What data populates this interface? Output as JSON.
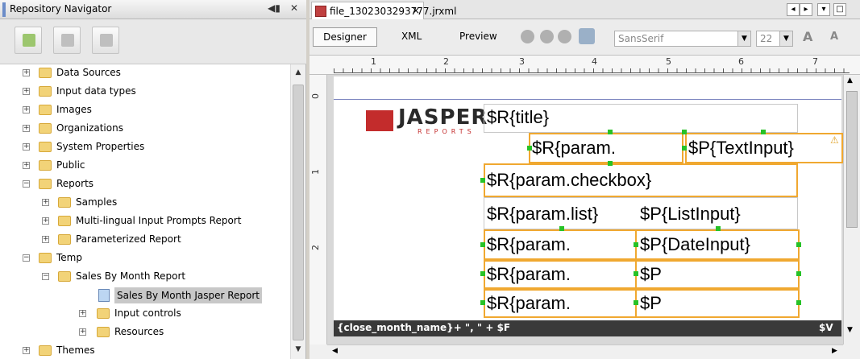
{
  "navigator": {
    "title": "Repository Navigator",
    "controls": "◀▮ ✕",
    "tree": [
      {
        "label": "Data Sources",
        "level": 1,
        "type": "folder"
      },
      {
        "label": "Input data types",
        "level": 1,
        "type": "folder"
      },
      {
        "label": "Images",
        "level": 1,
        "type": "folder"
      },
      {
        "label": "Organizations",
        "level": 1,
        "type": "folder"
      },
      {
        "label": "System Properties",
        "level": 1,
        "type": "folder"
      },
      {
        "label": "Public",
        "level": 1,
        "type": "folder"
      },
      {
        "label": "Reports",
        "level": 1,
        "type": "folder"
      },
      {
        "label": "Samples",
        "level": 2,
        "type": "folder"
      },
      {
        "label": "Multi-lingual Input Prompts Report",
        "level": 2,
        "type": "report"
      },
      {
        "label": "Parameterized Report",
        "level": 2,
        "type": "report"
      },
      {
        "label": "Temp",
        "level": 1,
        "type": "folder"
      },
      {
        "label": "Sales By Month Report",
        "level": 2,
        "type": "report"
      },
      {
        "label": "Sales By Month Jasper Report",
        "level": 3,
        "type": "jrxml"
      },
      {
        "label": "Input controls",
        "level": 3,
        "type": "folder"
      },
      {
        "label": "Resources",
        "level": 3,
        "type": "folder"
      },
      {
        "label": "Themes",
        "level": 1,
        "type": "folder"
      }
    ]
  },
  "editor": {
    "tab_label": "file_1302303293777.jrxml",
    "tab_close": "×",
    "views": [
      "Designer",
      "XML",
      "Preview"
    ],
    "font_family": "SansSerif",
    "font_size": "22",
    "ruler_numbers": [
      "1",
      "2",
      "3",
      "4",
      "5",
      "6",
      "7"
    ],
    "vruler_numbers": [
      "0",
      "1",
      "2"
    ],
    "logo_word": "JASPER",
    "logo_sub": "REPORTS",
    "fields": {
      "title": "$R{title}",
      "param1": "$R{param.",
      "textinput": "$P{TextInput}",
      "checkbox": "$R{param.checkbox}",
      "list": "$R{param.list}",
      "listinput": "$P{ListInput}",
      "param_date": "$R{param.",
      "dateinput": "$P{DateInput}",
      "param_a": "$R{param.",
      "p_a": "$P",
      "param_b": "$R{param.",
      "p_b": "$P"
    },
    "band_text": "{close_month_name}+ \", \" + $F",
    "band_right": "$V"
  }
}
